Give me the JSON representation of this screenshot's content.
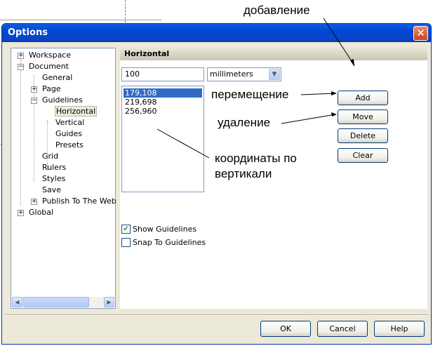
{
  "window": {
    "title": "Options",
    "close_label": "✕"
  },
  "tree": {
    "items": [
      {
        "label": "Workspace",
        "expander": "+"
      },
      {
        "label": "Document",
        "expander": "−"
      },
      {
        "label": "General"
      },
      {
        "label": "Page",
        "expander": "+"
      },
      {
        "label": "Guidelines",
        "expander": "−"
      },
      {
        "label": "Horizontal",
        "selected": true
      },
      {
        "label": "Vertical"
      },
      {
        "label": "Guides"
      },
      {
        "label": "Presets"
      },
      {
        "label": "Grid"
      },
      {
        "label": "Rulers"
      },
      {
        "label": "Styles"
      },
      {
        "label": "Save"
      },
      {
        "label": "Publish To The Web",
        "expander": "+"
      },
      {
        "label": "Global",
        "expander": "+"
      }
    ],
    "scroll_left": "◀",
    "scroll_right": "▶"
  },
  "panel": {
    "header": "Horizontal",
    "position_value": "100",
    "units": {
      "selected": "millimeters",
      "arrow": "▼"
    },
    "guidelines": [
      "179,108",
      "219,698",
      "256,960"
    ],
    "buttons": {
      "add": "Add",
      "move": "Move",
      "delete": "Delete",
      "clear": "Clear"
    },
    "show_guidelines": {
      "label": "Show Guidelines",
      "checked": true,
      "mark": "✔"
    },
    "snap_to_guidelines": {
      "label": "Snap To Guidelines",
      "checked": false
    }
  },
  "footer": {
    "ok": "OK",
    "cancel": "Cancel",
    "help": "Help"
  },
  "annotations": {
    "add": "добавление",
    "move": "перемещение",
    "delete": "удаление",
    "coords_line1": "координаты по",
    "coords_line2": "вертикали"
  }
}
